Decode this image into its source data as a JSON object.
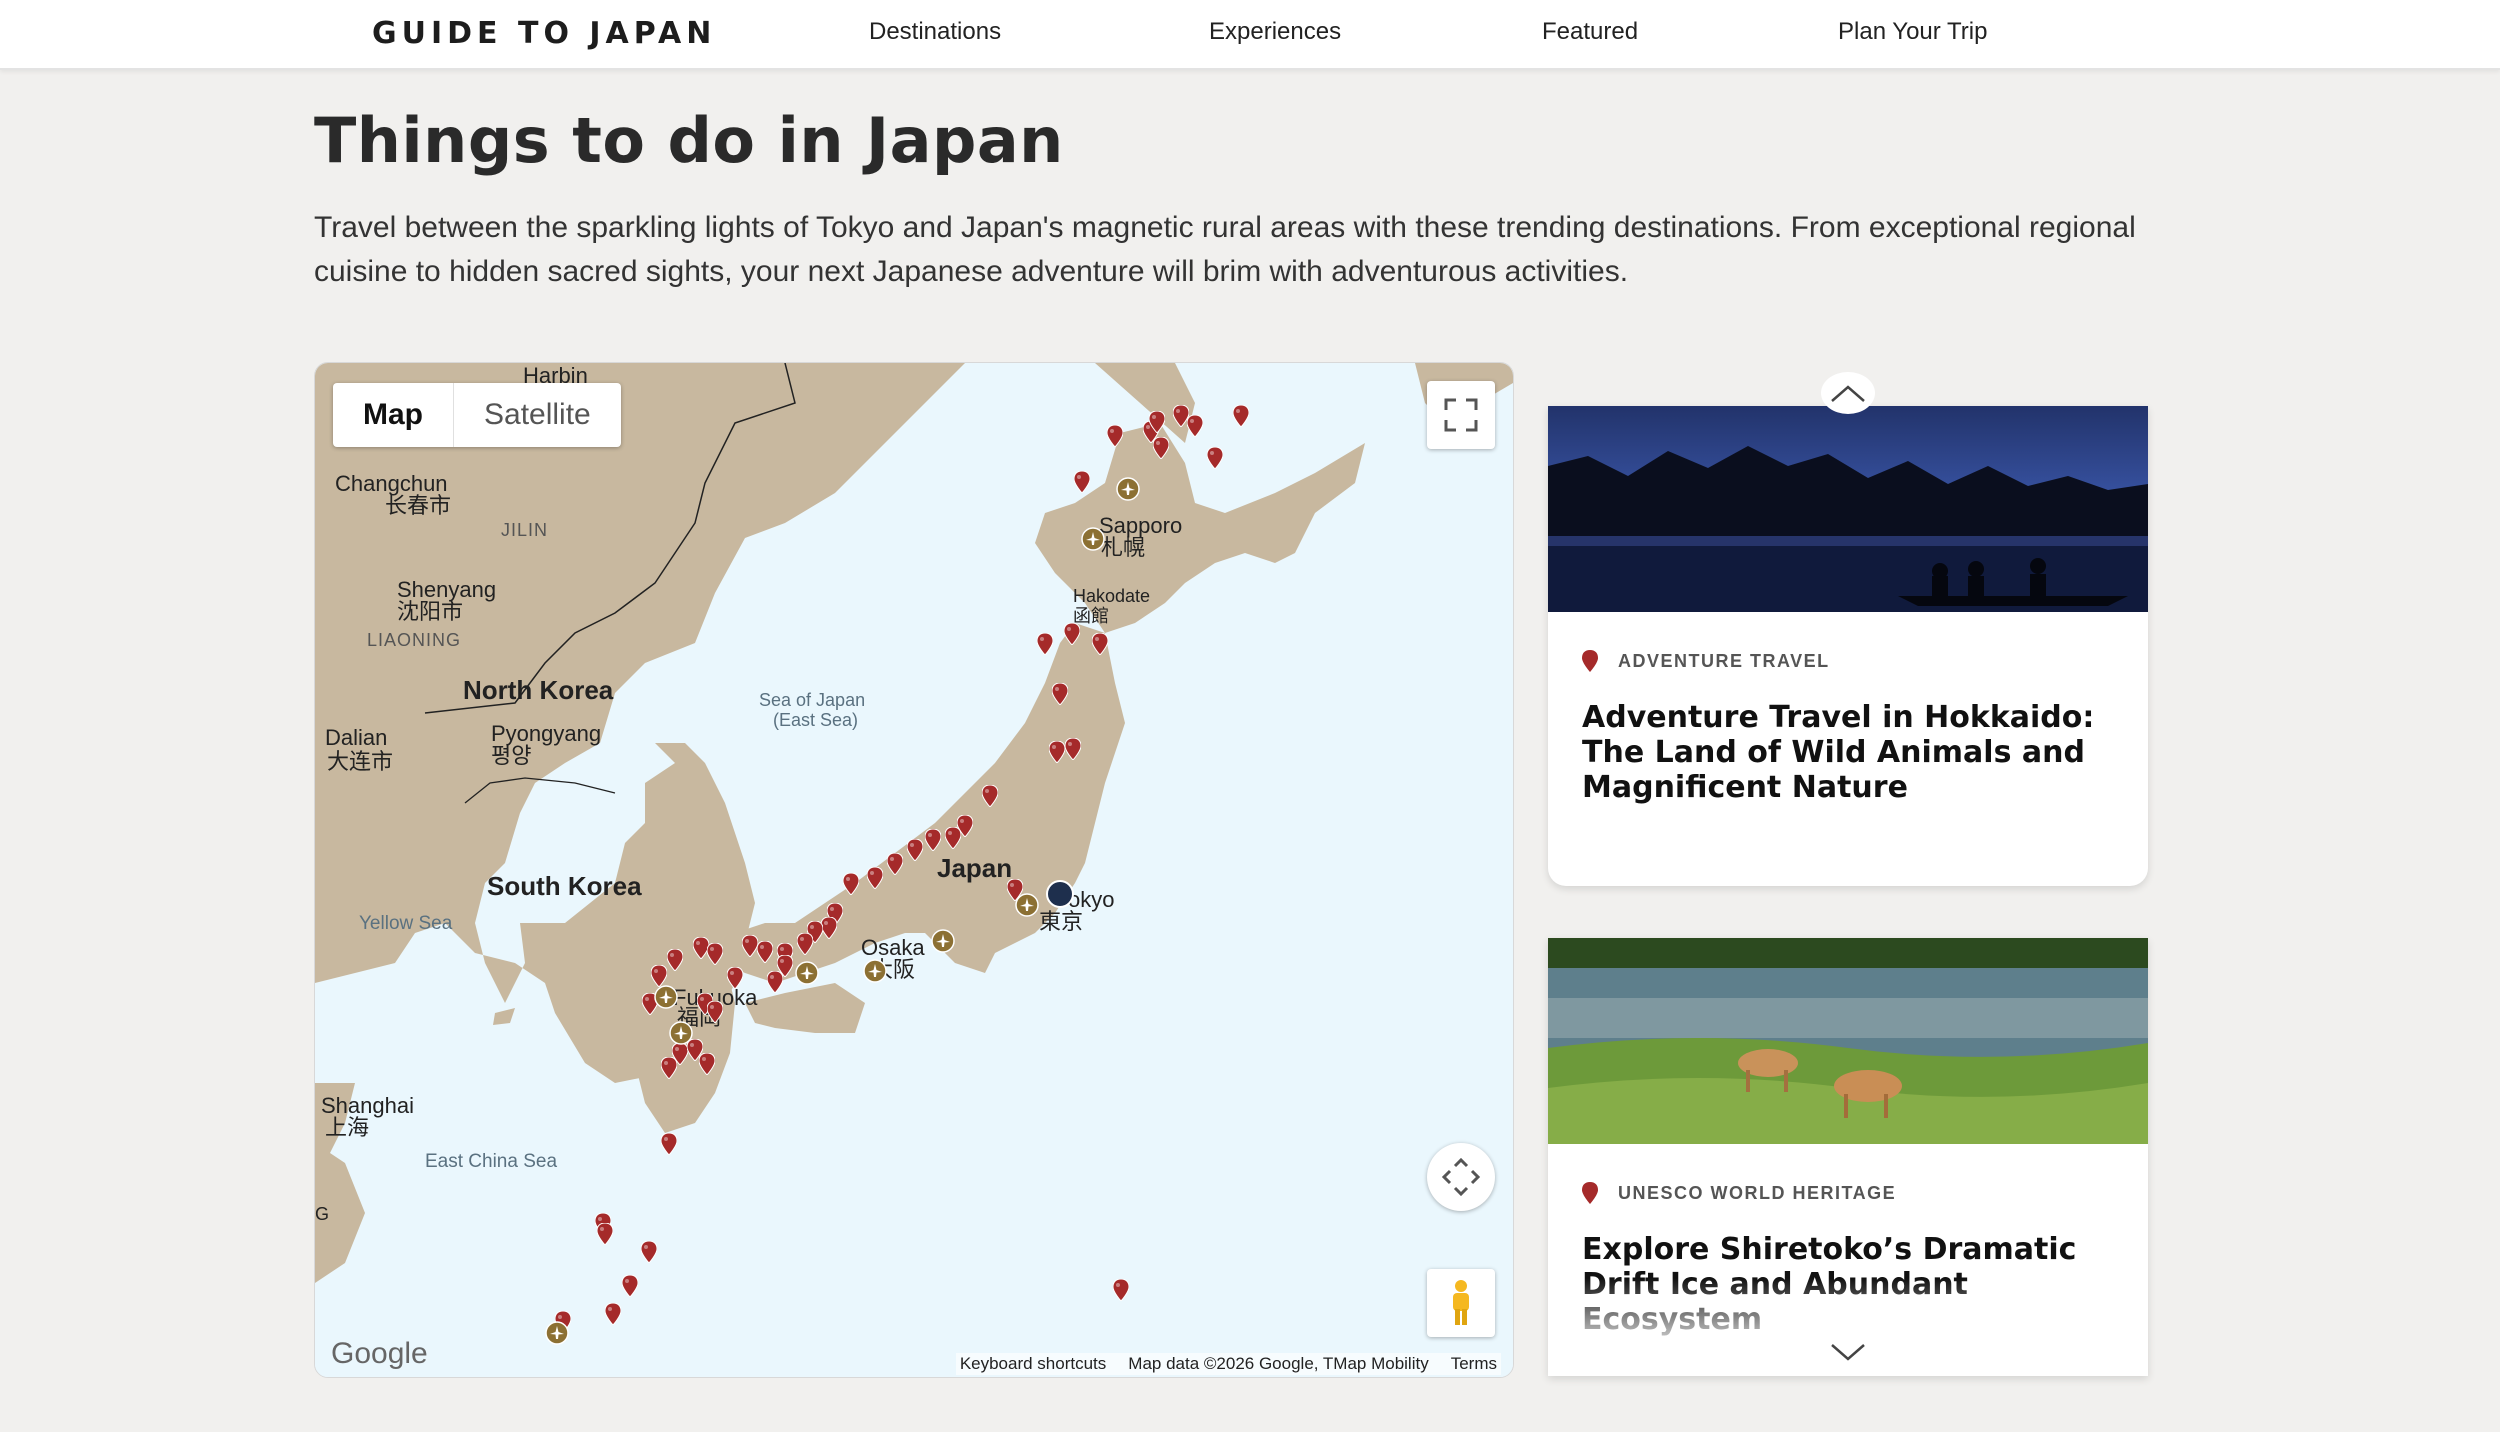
{
  "header": {
    "logo_text": "GUIDE TO JAPAN",
    "nav": [
      {
        "label": "Destinations"
      },
      {
        "label": "Experiences"
      },
      {
        "label": "Featured"
      },
      {
        "label": "Plan Your Trip"
      }
    ]
  },
  "page": {
    "title": "Things to do in Japan",
    "intro": "Travel between the sparkling lights of Tokyo and Japan's magnetic rural areas with these trending destinations. From exceptional regional cuisine to hidden sacred sights, your next Japanese adventure will brim with adventurous activities."
  },
  "map": {
    "type_buttons": {
      "map": "Map",
      "satellite": "Satellite"
    },
    "labels": {
      "harbin": "Harbin",
      "changchun": "Changchun",
      "changchun_local": "长春市",
      "jilin": "JILIN",
      "shenyang": "Shenyang",
      "shenyang_local": "沈阳市",
      "liaoning": "LIAONING",
      "north_korea": "North Korea",
      "dalian": "Dalian",
      "dalian_local": "大连市",
      "pyongyang": "Pyongyang",
      "pyongyang_local": "평양",
      "south_korea": "South Korea",
      "yellow_sea": "Yellow Sea",
      "sea_of_japan": "Sea of Japan",
      "sea_of_japan_alt": "(East Sea)",
      "sapporo": "Sapporo",
      "sapporo_local": "札幌",
      "hakodate": "Hakodate",
      "hakodate_local": "函館",
      "japan": "Japan",
      "tokyo": "Tokyo",
      "tokyo_local": "東京",
      "osaka": "Osaka",
      "osaka_local": "大阪",
      "fukuoka": "Fukuoka",
      "fukuoka_local": "福岡",
      "shanghai": "Shanghai",
      "shanghai_local": "上海",
      "east_china_sea": "East China Sea",
      "edge_g": "G"
    },
    "google_logo": "Google",
    "attribution": {
      "shortcuts": "Keyboard shortcuts",
      "data": "Map data ©2026 Google, TMap Mobility",
      "terms": "Terms"
    },
    "colors": {
      "land": "#c8b89f",
      "water": "#eaf7fd",
      "pin": "#a52a2a",
      "airport": "#8c7033"
    }
  },
  "cards": [
    {
      "tag": "ADVENTURE TRAVEL",
      "title": "Adventure Travel in Hokkaido: The Land of Wild Animals and Magnificent Nature"
    },
    {
      "tag": "UNESCO WORLD HERITAGE",
      "title": "Explore Shiretoko’s Dramatic Drift Ice and Abundant Ecosystem"
    }
  ]
}
